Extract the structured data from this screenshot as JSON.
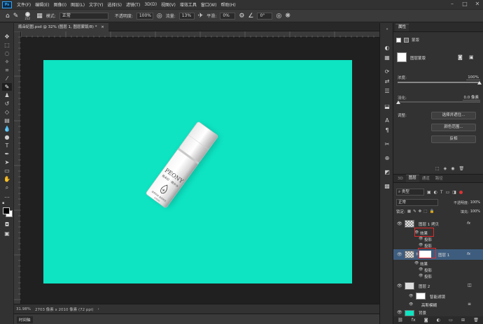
{
  "menu": {
    "logo": "Ps",
    "items": [
      "文件(F)",
      "编辑(E)",
      "图像(I)",
      "图层(L)",
      "文字(Y)",
      "选择(S)",
      "滤镜(T)",
      "3D(D)",
      "视图(V)",
      "增效工具",
      "窗口(W)",
      "帮助(H)"
    ]
  },
  "window_controls": {
    "minimize": "–",
    "maximize": "□",
    "close": "✕"
  },
  "options": {
    "brush_size": "212",
    "mode_label": "模式:",
    "mode_value": "正常",
    "opacity_label": "不透明度:",
    "opacity_value": "100%",
    "flow_label": "流量:",
    "flow_value": "13%",
    "smooth_label": "平滑:",
    "smooth_value": "0%",
    "angle_value": "0°"
  },
  "document": {
    "tab_title": "瓶朵妃图.psd @ 32% (图层 1, 图层蒙版/8) *",
    "tab_close": "×"
  },
  "status": {
    "zoom": "31.98%",
    "info": "2703 像素 x 2010 像素 (72 ppi)",
    "arrow": "›"
  },
  "timeline_label": "时间轴",
  "properties": {
    "tab": "属性",
    "kind_label": "蒙版",
    "layer_mask_label": "图层蒙版",
    "density_label": "浓度:",
    "density_value": "100%",
    "feather_label": "羽化:",
    "feather_value": "0.0 像素",
    "adjust_label": "调整:",
    "select_and_mask": "选择并遮住...",
    "color_range": "颜色范围...",
    "invert": "反相"
  },
  "layers_panel": {
    "tabs": [
      "3D",
      "图层",
      "通道",
      "路径"
    ],
    "filter_kind": "类型",
    "blend_mode": "正常",
    "opacity_label": "不透明度:",
    "opacity_value": "100%",
    "lock_label": "锁定:",
    "fill_label": "填充:",
    "fill_value": "100%",
    "layers": [
      {
        "name": "图层 1 拷贝",
        "fx": "fx",
        "effects_label": "效果",
        "effects": [
          "投影",
          "投影"
        ]
      },
      {
        "name": "图层 1",
        "fx": "fx",
        "effects_label": "效果",
        "effects": [
          "投影",
          "投影"
        ]
      },
      {
        "name": "图层 2",
        "smart_filters": "智能滤镜",
        "filters": [
          "高斯模糊"
        ]
      },
      {
        "name": "背景"
      }
    ]
  },
  "product": {
    "brand": "PEONY",
    "line2": "瓶朵妃 · 精华水",
    "tagline": "滋养肌肤 焕亮新生",
    "volume": "100ml"
  },
  "colors": {
    "canvas": "#0ee3c2",
    "accent": "#31a8ff",
    "highlight": "#e12b2b"
  }
}
